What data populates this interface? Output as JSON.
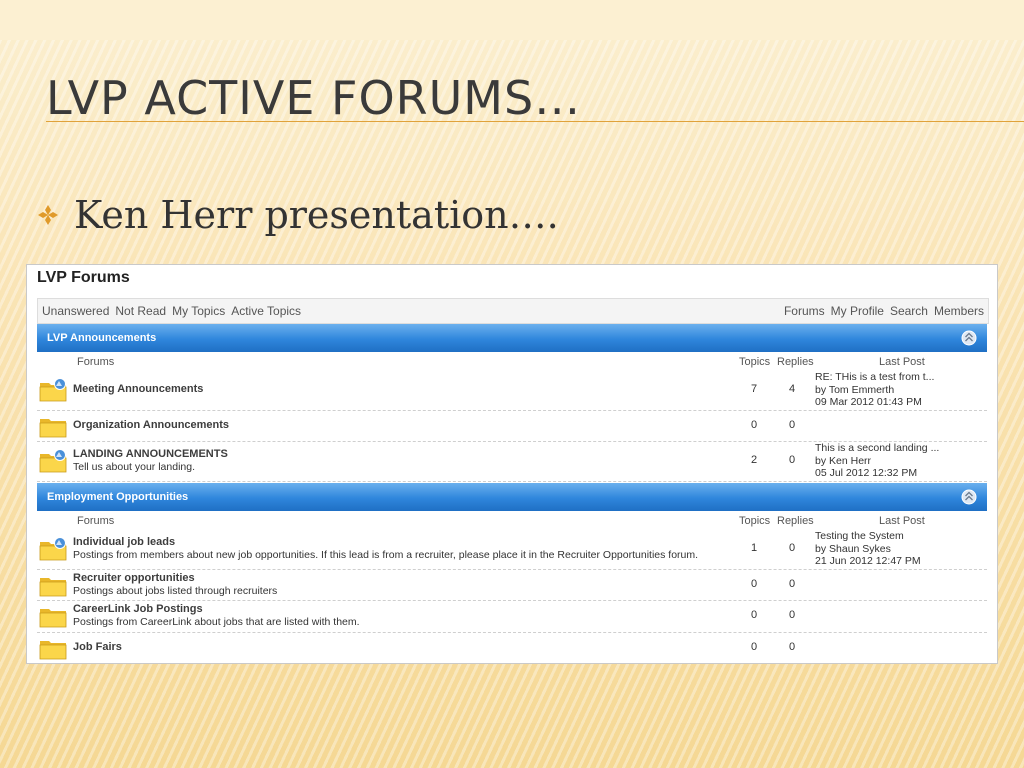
{
  "slide": {
    "title": "LVP Active Forums…",
    "bullet": "Ken Herr presentation…."
  },
  "forum": {
    "site_title": "LVP Forums",
    "nav_left": [
      "Unanswered",
      "Not Read",
      "My Topics",
      "Active Topics"
    ],
    "nav_right": [
      "Forums",
      "My Profile",
      "Search",
      "Members"
    ],
    "columns": {
      "forums": "Forums",
      "topics": "Topics",
      "replies": "Replies",
      "last_post": "Last Post"
    },
    "categories": [
      {
        "name": "LVP Announcements",
        "rows": [
          {
            "name": "Meeting Announcements",
            "desc": "",
            "topics": "7",
            "replies": "4",
            "last_post": [
              "RE: THis is a test from t...",
              "by Tom Emmerth",
              "09 Mar 2012 01:43 PM"
            ],
            "icon": "folder-new-icon"
          },
          {
            "name": "Organization Announcements",
            "desc": "",
            "topics": "0",
            "replies": "0",
            "last_post": [],
            "icon": "folder-icon"
          },
          {
            "name": "LANDING ANNOUNCEMENTS",
            "desc": "Tell us about your landing.",
            "topics": "2",
            "replies": "0",
            "last_post": [
              "This is a second landing ...",
              "by Ken Herr",
              "05 Jul 2012 12:32 PM"
            ],
            "icon": "folder-new-icon"
          }
        ]
      },
      {
        "name": "Employment Opportunities",
        "rows": [
          {
            "name": "Individual job leads",
            "desc": "Postings from members about new job opportunities. If this lead is from a recruiter, please place it in the Recruiter Opportunities forum.",
            "topics": "1",
            "replies": "0",
            "last_post": [
              "Testing the System",
              "by Shaun Sykes",
              "21 Jun 2012 12:47 PM"
            ],
            "icon": "folder-new-icon"
          },
          {
            "name": "Recruiter opportunities",
            "desc": "Postings about jobs listed through recruiters",
            "topics": "0",
            "replies": "0",
            "last_post": [],
            "icon": "folder-icon"
          },
          {
            "name": "CareerLink Job Postings",
            "desc": "Postings from CareerLink about jobs that are listed with them.",
            "topics": "0",
            "replies": "0",
            "last_post": [],
            "icon": "folder-icon"
          },
          {
            "name": "Job Fairs",
            "desc": "",
            "topics": "0",
            "replies": "0",
            "last_post": [],
            "icon": "folder-icon"
          }
        ]
      }
    ]
  }
}
